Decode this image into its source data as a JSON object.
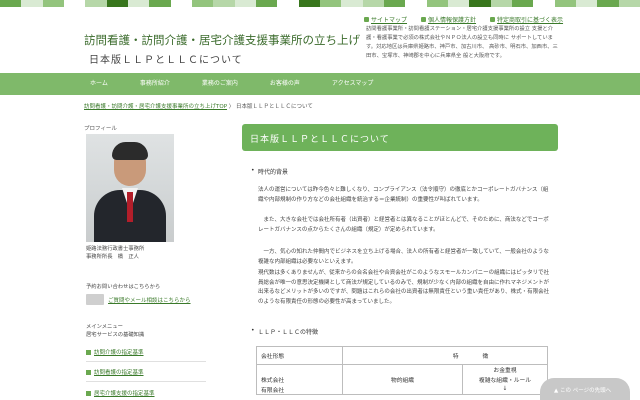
{
  "site": {
    "title": "訪問看護・訪問介護・居宅介護支援事業所の立ち上げ",
    "subtitle": "日本版ＬＬＰとＬＬＣについて",
    "description": "訪問看護事業所・訪問看護ステーション・居宅介護支援事業所の設立 支援と介護・看護事業で必須の株式会社やＮＰＯ法人の設立も同時に サポートしています。対応地区は兵庫県姫路市、神戸市、加古川市、 高砂市、明石市、加西市、三田市、宝塚市、神崎郡を中心に兵庫県全 般と大阪府です。"
  },
  "stripe_colors": [
    "#6aa84f",
    "#d9ead3",
    "#93c47d",
    "#ffffff",
    "#b6d7a8",
    "#38761d",
    "#d9ead3",
    "#6aa84f",
    "#ffffff",
    "#93c47d",
    "#b6d7a8",
    "#d9ead3",
    "#6aa84f",
    "#ffffff",
    "#38761d",
    "#93c47d",
    "#d9ead3",
    "#b6d7a8",
    "#6aa84f",
    "#ffffff",
    "#93c47d",
    "#d9ead3",
    "#38761d",
    "#b6d7a8",
    "#6aa84f",
    "#ffffff",
    "#93c47d",
    "#d9ead3",
    "#6aa84f",
    "#b6d7a8"
  ],
  "toplinks": [
    "サイトマップ",
    "個人情報保護方針",
    "特定商取引に基づく表示"
  ],
  "nav": [
    "ホーム",
    "事務所紹介",
    "業務のご案内",
    "お客様の声",
    "アクセスマップ"
  ],
  "breadcrumb": {
    "home": "訪問看護・訪問介護・居宅介護支援事業所の立ち上げTOP",
    "sep": "〉",
    "current": "日本版ＬＬＰとＬＬＣについて"
  },
  "sidebar": {
    "profile_heading": "プロフィール",
    "photo_caption_1": "姫路法務行政書士事務所",
    "photo_caption_2": "事務所所長　橋　正人",
    "contact_heading": "予約お問い合わせはこちらから",
    "contact_link": "ご質問やメール相談はこちらから",
    "menu_heading": "メインメニュー",
    "menu_subheading": "居宅サービスの基礎知識",
    "menu_items": [
      "訪問介護の指定基準",
      "訪問看護の指定基準",
      "居宅介護支援の指定基準"
    ]
  },
  "main": {
    "title": "日本版ＬＬＰとＬＬＣについて",
    "bullet_1": "時代的背景",
    "para_1": "法人の運営については昨今色々と難しくなり、コンプライアンス（法令順守）の徹底とかコーポレートガバナンス（組織や内部規制の作り方などの会社組織を統治する＝企業統制）の重要性が叫ばれています。",
    "para_2": "　また、大きな会社では会社所有者（出資者）と経営者とは異なることがほとんどで、そのために、商法などでコーポレートガバナンスの点からたくさんの組織（規定）が定められています。",
    "para_3": "　一方、気心の知れた仲間内でビジネスを立ち上げる場合、法人の所有者と経営者が一致していて、一般会社のような複雑な内部組織は必要ないといえます。",
    "para_4": "現代数は多くありませんが、従来からの合名会社や合資会社がこのようなスモールカンパニーの組織にはピッタリで社員総会が唯一の意思決定機関として商法が規定しているのみで、規制が少なく内部の組織を自由に作れマネジメントが出来るなどメリットが多いのですが、問題はこれらの会社の出資者は無限責任という重い責任があり、株式・有限会社のような有限責任の形態の必要性が高まっていました。",
    "bullet_2": "ＬＬＰ・ＬＬＣの特徴",
    "table": {
      "header": [
        "会社形態",
        "特",
        "徴"
      ],
      "row_1": [
        "株式会社",
        "物的組織",
        "お金重視"
      ],
      "row_1b": [
        "有限会社",
        "",
        "複雑な組織・ルール"
      ],
      "row_1c": [
        "",
        "",
        "↓"
      ]
    }
  },
  "scroll_top": "この ページの先頭へ"
}
